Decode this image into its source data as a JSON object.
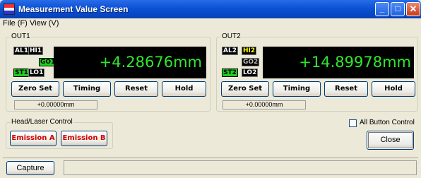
{
  "window": {
    "title": "Measurement Value Screen"
  },
  "title_buttons": {
    "minimize": "_",
    "maximize": "□",
    "close": "✕"
  },
  "menu": {
    "file": "File (F)",
    "view": "View (V)"
  },
  "out1": {
    "label": "OUT1",
    "tags": {
      "alarm": "AL1",
      "hi": "HI1",
      "go": "GO1",
      "strobe": "ST1",
      "lo": "LO1"
    },
    "value": "+4.28676mm",
    "buttons": {
      "zero_set": "Zero Set",
      "timing": "Timing",
      "reset": "Reset",
      "hold": "Hold"
    },
    "readout": "+0.00000mm"
  },
  "out2": {
    "label": "OUT2",
    "tags": {
      "alarm": "AL2",
      "hi": "HI2",
      "go": "GO2",
      "strobe": "ST2",
      "lo": "LO2"
    },
    "value": "+14.89978mm",
    "buttons": {
      "zero_set": "Zero Set",
      "timing": "Timing",
      "reset": "Reset",
      "hold": "Hold"
    },
    "readout": "+0.00000mm"
  },
  "laser": {
    "label": "Head/Laser Control",
    "emission_a": "Emission A",
    "emission_b": "Emission B"
  },
  "all_button_control": {
    "label": "All Button Control",
    "checked": false
  },
  "close_button": "Close",
  "capture_button": "Capture",
  "colors": {
    "display_text": "#2ee82e",
    "go_indicator": "#1fcf1f",
    "hi_active": "#ffff00",
    "emission_text": "#d40000",
    "titlebar": "#0a52d6"
  },
  "icons": {
    "app": "app-icon",
    "minimize": "minimize-icon",
    "maximize": "maximize-icon",
    "close": "close-icon"
  }
}
